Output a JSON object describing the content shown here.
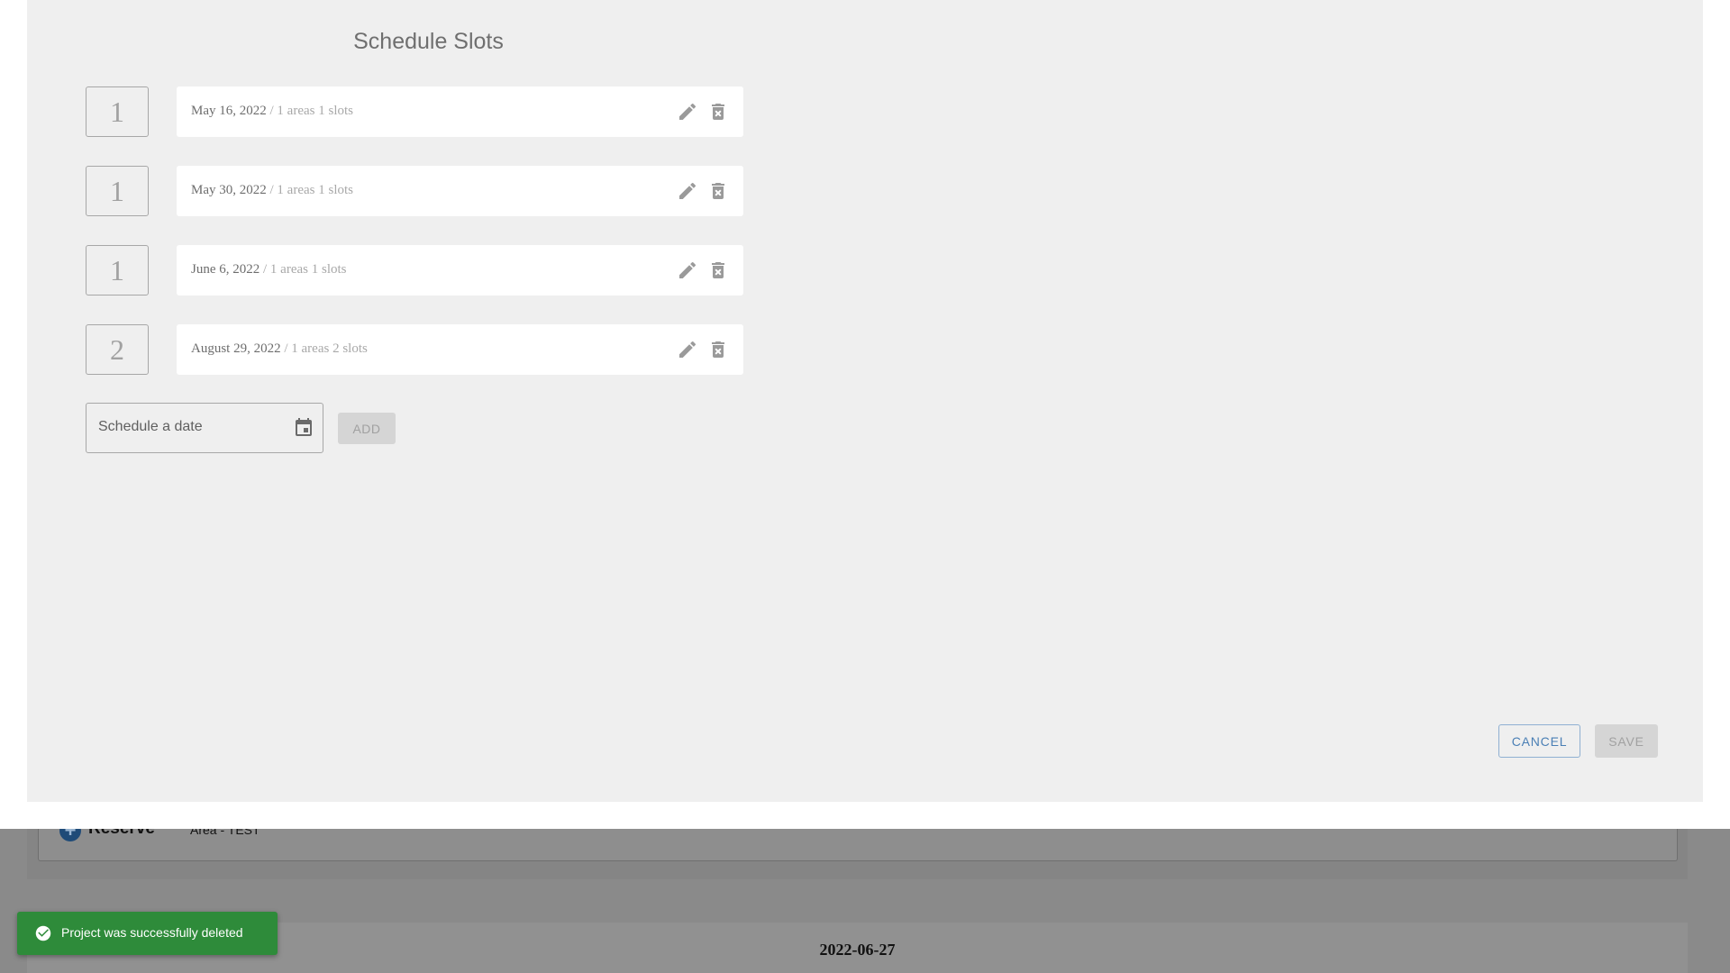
{
  "background": {
    "reserve_label": "Reserve",
    "area_label": "Area - TEST",
    "next_section_date": "2022-06-27"
  },
  "dialog": {
    "title": "Schedule Slots",
    "slots": [
      {
        "count": "1",
        "date": "May 16, 2022",
        "separator": " / ",
        "detail": "1 areas 1 slots"
      },
      {
        "count": "1",
        "date": "May 30, 2022",
        "separator": " / ",
        "detail": "1 areas 1 slots"
      },
      {
        "count": "1",
        "date": "June 6, 2022",
        "separator": " / ",
        "detail": "1 areas 1 slots"
      },
      {
        "count": "2",
        "date": "August 29, 2022",
        "separator": " / ",
        "detail": "1 areas 2 slots"
      }
    ],
    "date_field": {
      "placeholder": "Schedule a date",
      "value": ""
    },
    "add_label": "ADD",
    "cancel_label": "CANCEL",
    "save_label": "SAVE"
  },
  "toast": {
    "message": "Project was successfully deleted"
  },
  "icons": {
    "slot_edit": "pencil-icon",
    "slot_delete": "delete-icon",
    "date_picker": "calendar-icon",
    "toast_status": "check-circle-icon",
    "reserve": "plus-circle-icon"
  },
  "colors": {
    "cancel_accent": "#4a7fb5",
    "toast_success": "#2e8b3a",
    "disabled_button": "#d5d5d5"
  }
}
